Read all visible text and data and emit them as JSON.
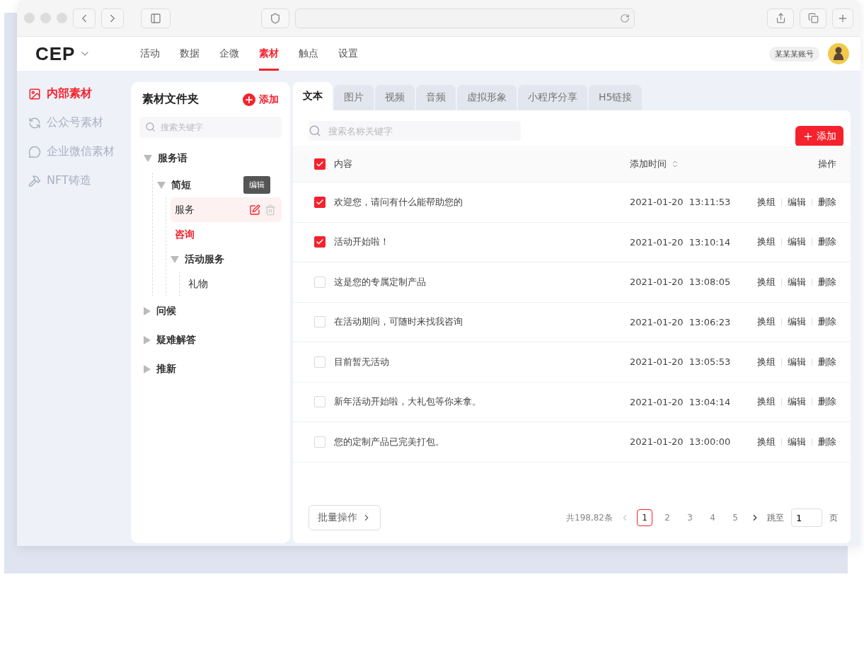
{
  "header": {
    "logo": "CEP",
    "nav": [
      {
        "label": "活动",
        "selected": false
      },
      {
        "label": "数据",
        "selected": false
      },
      {
        "label": "企微",
        "selected": false
      },
      {
        "label": "素材",
        "selected": true
      },
      {
        "label": "触点",
        "selected": false
      },
      {
        "label": "设置",
        "selected": false
      }
    ],
    "account": "某某某账号"
  },
  "sidebar": {
    "items": [
      {
        "label": "内部素材",
        "selected": true
      },
      {
        "label": "公众号素材",
        "selected": false
      },
      {
        "label": "企业微信素材",
        "selected": false
      },
      {
        "label": "NFT铸造",
        "selected": false
      }
    ]
  },
  "folders": {
    "title": "素材文件夹",
    "add": "添加",
    "placeholder": "搜索关键字",
    "tree": [
      {
        "label": "服务语",
        "expanded": true,
        "selected": false,
        "children": [
          {
            "label": "简短",
            "expanded": true,
            "selected": false,
            "children": [
              {
                "label": "服务",
                "selected": false,
                "hovered": true,
                "tooltip": "编辑"
              },
              {
                "label": "咨询",
                "selected": true,
                "hovered": false
              },
              {
                "label": "活动服务",
                "expanded": true,
                "selected": false,
                "children": [
                  {
                    "label": "礼物",
                    "selected": false,
                    "hovered": false
                  }
                ]
              }
            ]
          }
        ]
      },
      {
        "label": "问候",
        "expanded": false,
        "selected": false
      },
      {
        "label": "疑难解答",
        "expanded": false,
        "selected": false
      },
      {
        "label": "推新",
        "expanded": false,
        "selected": false
      }
    ]
  },
  "tabs": [
    {
      "label": "文本",
      "selected": true
    },
    {
      "label": "图片",
      "selected": false
    },
    {
      "label": "视频",
      "selected": false
    },
    {
      "label": "音频",
      "selected": false
    },
    {
      "label": "虚拟形象",
      "selected": false
    },
    {
      "label": "小程序分享",
      "selected": false
    },
    {
      "label": "H5链接",
      "selected": false
    }
  ],
  "table": {
    "placeholder": "搜索名称关键字",
    "add": "添加",
    "all_checked": true,
    "columns": [
      "内容",
      "添加时间",
      "操作"
    ],
    "rows": [
      {
        "checked": true,
        "content": "欢迎您，请问有什么能帮助您的",
        "time": "2021-01-20  13:11:53",
        "actions": [
          "换组",
          "编辑",
          "删除"
        ]
      },
      {
        "checked": true,
        "content": "活动开始啦！",
        "time": "2021-01-20  13:10:14",
        "actions": [
          "换组",
          "编辑",
          "删除"
        ]
      },
      {
        "checked": false,
        "content": "这是您的专属定制产品",
        "time": "2021-01-20  13:08:05",
        "actions": [
          "换组",
          "编辑",
          "删除"
        ]
      },
      {
        "checked": false,
        "content": "在活动期间，可随时来找我咨询",
        "time": "2021-01-20  13:06:23",
        "actions": [
          "换组",
          "编辑",
          "删除"
        ]
      },
      {
        "checked": false,
        "content": "目前暂无活动",
        "time": "2021-01-20  13:05:53",
        "actions": [
          "换组",
          "编辑",
          "删除"
        ]
      },
      {
        "checked": false,
        "content": "新年活动开始啦，大礼包等你来拿。",
        "time": "2021-01-20  13:04:14",
        "actions": [
          "换组",
          "编辑",
          "删除"
        ]
      },
      {
        "checked": false,
        "content": "您的定制产品已完美打包。",
        "time": "2021-01-20  13:00:00",
        "actions": [
          "换组",
          "编辑",
          "删除"
        ]
      }
    ]
  },
  "footer": {
    "batch": "批量操作",
    "total": "共198,82条",
    "pages": [
      {
        "label": "1",
        "selected": true
      },
      {
        "label": "2",
        "selected": false
      },
      {
        "label": "3",
        "selected": false
      },
      {
        "label": "4",
        "selected": false
      },
      {
        "label": "5",
        "selected": false
      }
    ],
    "jump": "跳至",
    "jump_value": "1",
    "page_unit": "页"
  }
}
